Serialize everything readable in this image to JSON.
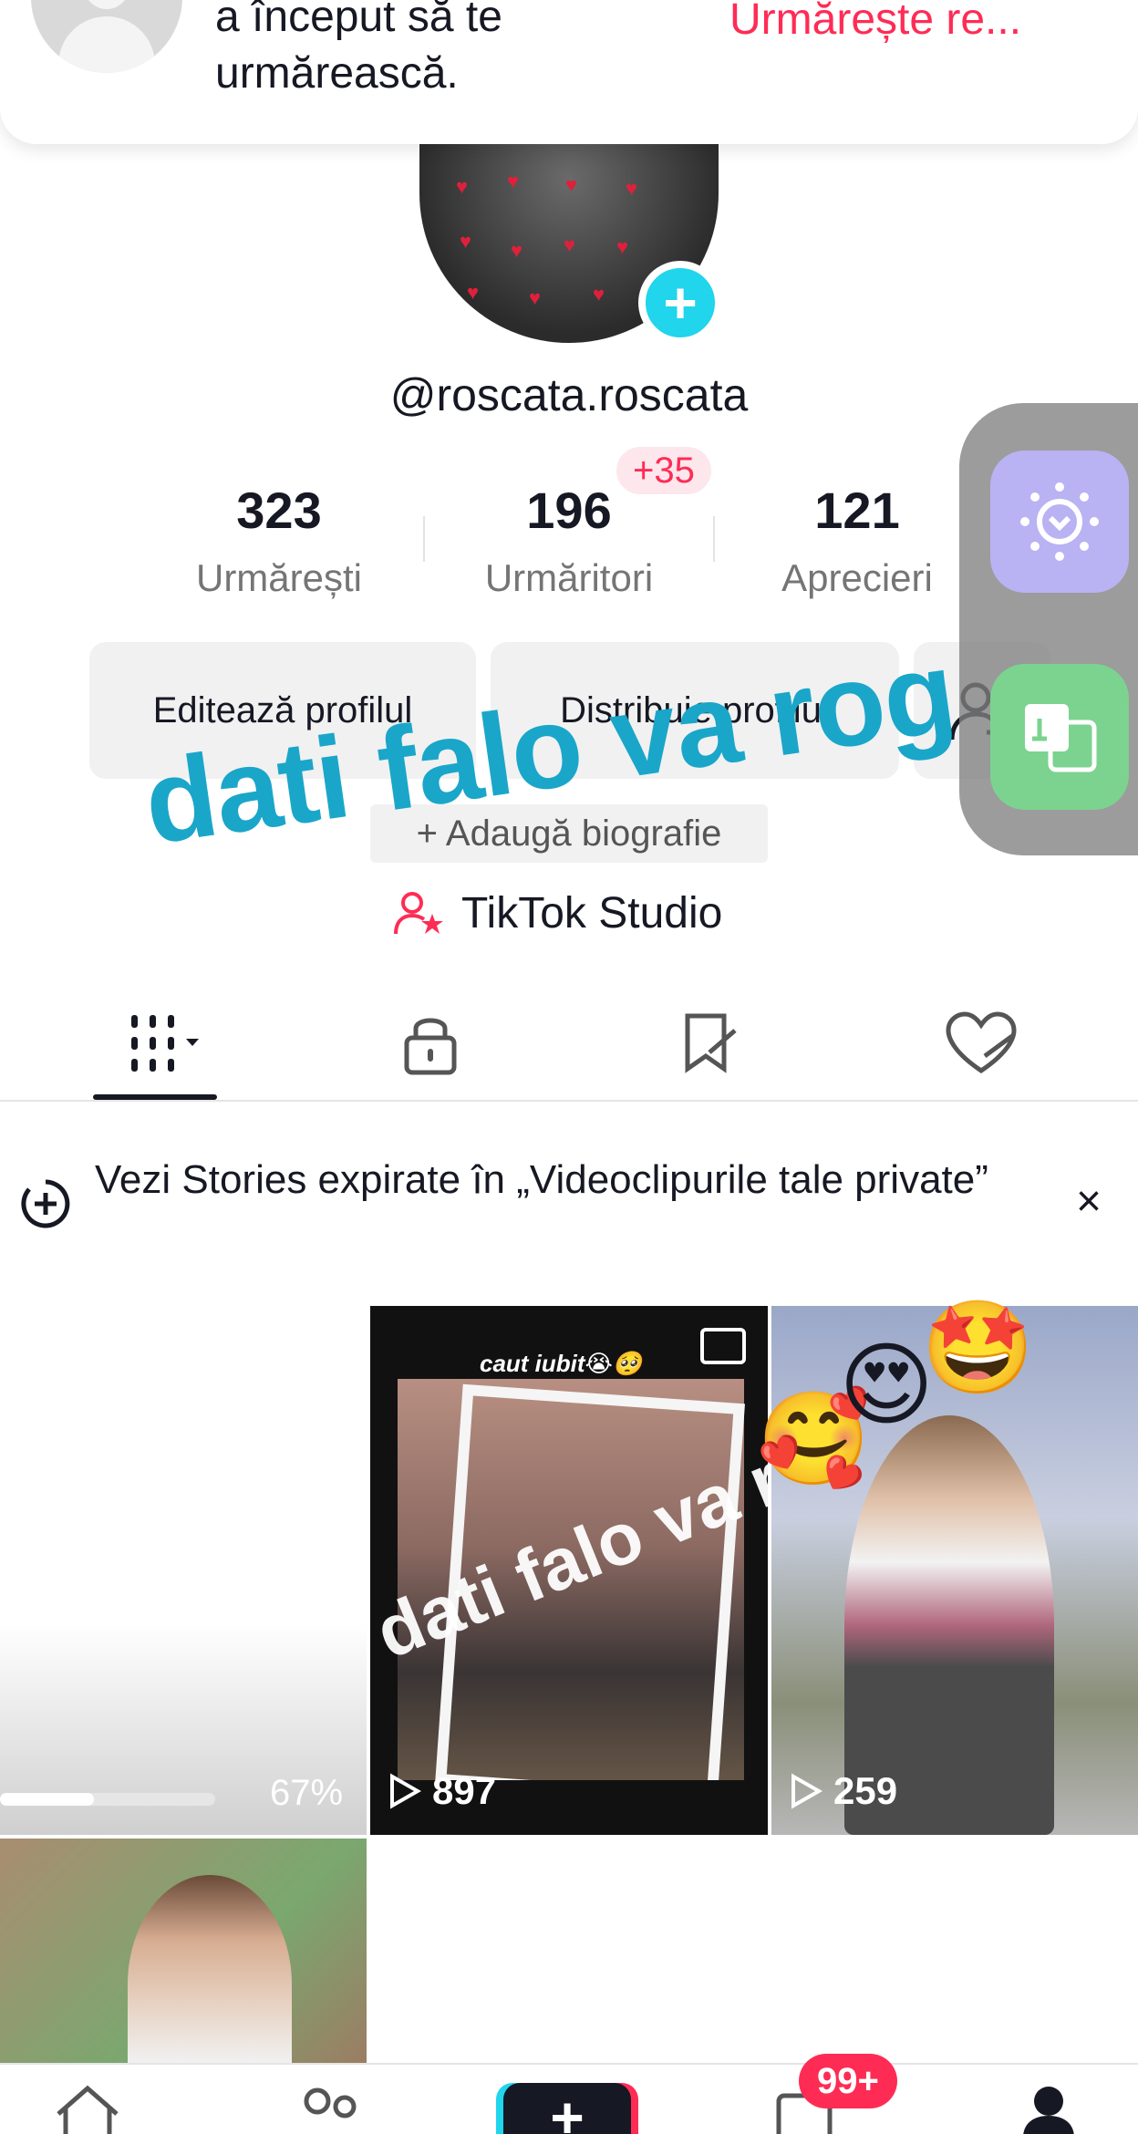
{
  "notification": {
    "text": "a început să te\nurmărească.",
    "action": "Urmărește re..."
  },
  "profile": {
    "username": "@roscata.roscata",
    "stats": [
      {
        "value": "323",
        "label": "Urmărești"
      },
      {
        "value": "196",
        "label": "Urmăritori"
      },
      {
        "value": "121",
        "label": "Aprecieri"
      }
    ],
    "new_followers_badge": "+35",
    "edit_button": "Editează profilul",
    "share_button": "Distribuie profilul",
    "bio_placeholder": "+ Adaugă biografie",
    "studio_link": "TikTok Studio",
    "overlay_caption": "dati falo va rog"
  },
  "stories_banner": {
    "text": "Vezi Stories expirate în „Videoclipurile tale private”",
    "close": "×"
  },
  "grid": {
    "upload_progress_value": 0.67,
    "upload_progress_text": "67%",
    "tiles": [
      {
        "views": "897",
        "caption": "caut iubit😭🥺",
        "overlay": "dati falo va rog"
      },
      {
        "views": "259"
      }
    ]
  },
  "icons": {
    "tabs": [
      "grid-menu-icon",
      "lock-icon",
      "bookmark-icon",
      "heart-icon"
    ],
    "nav": [
      "home-icon",
      "friends-icon",
      "create-icon",
      "inbox-icon",
      "profile-icon"
    ]
  },
  "bottom_nav": {
    "create_label": "+",
    "inbox_badge": "99+"
  },
  "colors": {
    "accent": "#fe2c55",
    "cyan": "#20d5ec",
    "overlay_text": "#1aa6c9"
  }
}
